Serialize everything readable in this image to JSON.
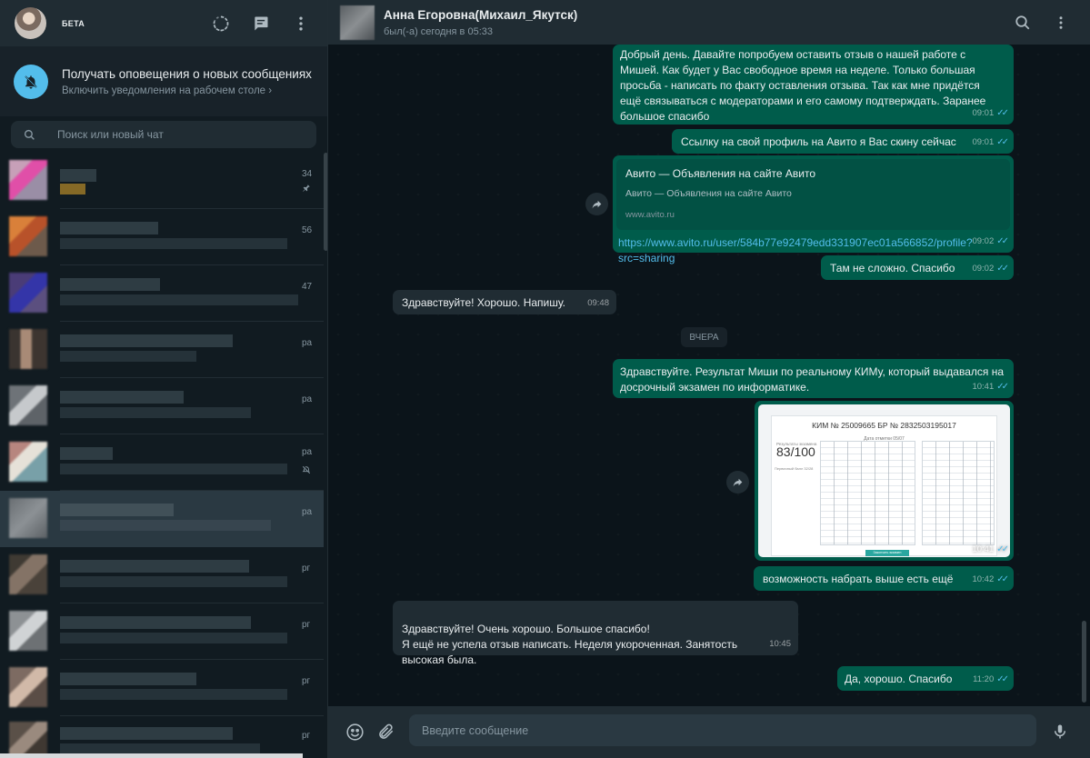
{
  "sidebar": {
    "beta_label": "БЕТА",
    "notification": {
      "title": "Получать оповещения о новых сообщениях",
      "subtitle": "Включить уведомления на рабочем столе ›"
    },
    "search_placeholder": "Поиск или новый чат",
    "chat_times": [
      "34",
      "56",
      "47",
      "ра",
      "ра",
      "ра",
      "ра",
      "рг",
      "рг",
      "рг",
      "рг"
    ]
  },
  "chat": {
    "contact_name": "Анна Егоровна(Михаил_Якутск)",
    "contact_status": "был(-а) сегодня в 05:33",
    "date_divider": "ВЧЕРА",
    "messages": [
      {
        "text": "Добрый день. Давайте попробуем оставить отзыв о нашей работе с Мишей. Как будет у Вас свободное время на неделе. Только большая просьба - написать по факту оставления отзыва. Так как мне придётся ещё связываться с модераторами и его самому подтверждать. Заранее большое спасибо",
        "time": "09:01"
      },
      {
        "text": "Ссылку на свой профиль на Авито я Вас скину сейчас",
        "time": "09:01"
      },
      {
        "link_title": "Авито — Объявления на сайте Авито",
        "link_desc": "Авито — Объявления на сайте Авито",
        "link_host": "www.avito.ru",
        "text": "https://www.avito.ru/user/584b77e92479edd331907ec01a566852/profile?src=sharing",
        "time": "09:02"
      },
      {
        "text": "Там не сложно. Спасибо",
        "time": "09:02"
      },
      {
        "text": "Здравствуйте! Хорошо. Напишу.",
        "time": "09:48"
      },
      {
        "text": "Здравствуйте. Результат Миши по реальному КИМу, который выдавался на досрочный экзамен по информатике.",
        "time": "10:41"
      },
      {
        "doc_title": "КИМ № 25009665 БР № 2832503195017",
        "doc_sub": "Дата отметки 05/07",
        "score_label": "Результаты экзамена",
        "score": "83/100",
        "score_sub": "Первичный балл 32/28",
        "button": "Закончить экзамен",
        "time": "10:41"
      },
      {
        "text": "возможность набрать выше есть ещё",
        "time": "10:42"
      },
      {
        "text": "Здравствуйте! Очень хорошо. Большое спасибо!\nЯ ещё не успела отзыв написать. Неделя укороченная. Занятость высокая была.",
        "time": "10:45"
      },
      {
        "text": "Да, хорошо. Спасибо",
        "time": "11:20"
      }
    ]
  },
  "composer": {
    "placeholder": "Введите сообщение"
  },
  "icons": {
    "status": "status-icon",
    "new_chat": "new-chat-icon",
    "menu": "menu-icon",
    "search": "search-icon",
    "bell_off": "bell-off-icon",
    "emoji": "emoji-icon",
    "attach": "attach-icon",
    "mic": "mic-icon",
    "forward": "forward-icon",
    "double_check": "double-check-icon"
  },
  "colors": {
    "outgoing_bubble": "#005c4b",
    "incoming_bubble": "#202c33",
    "accent": "#53bdeb",
    "background": "#0b141a"
  }
}
